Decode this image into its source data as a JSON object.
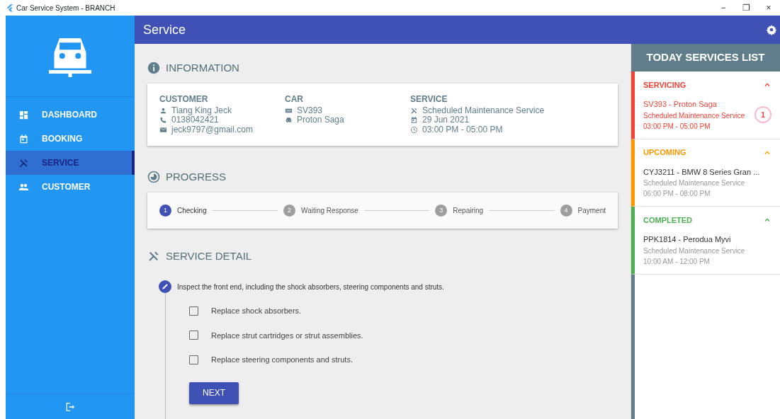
{
  "window": {
    "title": "Car Service System - BRANCH",
    "controls": [
      "−",
      "❐",
      "×"
    ]
  },
  "sidebar": {
    "items": [
      {
        "label": "DASHBOARD",
        "selected": false
      },
      {
        "label": "BOOKING",
        "selected": false
      },
      {
        "label": "SERVICE",
        "selected": true
      },
      {
        "label": "CUSTOMER",
        "selected": false
      }
    ]
  },
  "header": {
    "title": "Service"
  },
  "information": {
    "title": "INFORMATION",
    "columns": [
      {
        "heading": "CUSTOMER",
        "lines": [
          "Tiang King Jeck",
          "0138042421",
          "jeck9797@gmail.com"
        ]
      },
      {
        "heading": "CAR",
        "lines": [
          "SV393",
          "Proton Saga"
        ]
      },
      {
        "heading": "SERVICE",
        "lines": [
          "Scheduled Maintenance Service",
          "29 Jun 2021",
          "03:00 PM - 05:00 PM"
        ]
      }
    ]
  },
  "progress": {
    "title": "PROGRESS",
    "steps": [
      {
        "number": "1",
        "label": "Checking",
        "selected": true
      },
      {
        "number": "2",
        "label": "Waiting Response",
        "selected": false
      },
      {
        "number": "3",
        "label": "Repairing",
        "selected": false
      },
      {
        "number": "4",
        "label": "Payment",
        "selected": false
      }
    ]
  },
  "service_detail": {
    "title": "SERVICE DETAIL",
    "instruction": "Inspect the front end, including the shock absorbers, steering components and struts.",
    "tasks": [
      {
        "label": "Replace shock absorbers.",
        "checked": false
      },
      {
        "label": "Replace strut cartridges or strut assemblies.",
        "checked": false
      },
      {
        "label": "Replace steering components and struts.",
        "checked": false
      }
    ],
    "button": "NEXT"
  },
  "today_list": {
    "title": "TODAY SERVICES LIST",
    "groups": [
      {
        "status": "SERVICING",
        "color": "#f44336",
        "expanded": true,
        "items": [
          {
            "title": "SV393 - Proton Saga",
            "subtitle": "Scheduled Maintenance Service",
            "time": "03:00 PM - 05:00 PM",
            "badge": "1",
            "highlighted": true
          }
        ]
      },
      {
        "status": "UPCOMING",
        "color": "#ff9800",
        "expanded": true,
        "items": [
          {
            "title": "CYJ3211 - BMW 8 Series Gran ...",
            "subtitle": "Scheduled Maintenance Service",
            "time": "06:00 PM - 08:00 PM",
            "highlighted": false
          }
        ]
      },
      {
        "status": "COMPLETED",
        "color": "#4caf50",
        "expanded": true,
        "items": [
          {
            "title": "PPK1814 - Perodua Myvi",
            "subtitle": "Scheduled Maintenance Service",
            "time": "10:00 AM - 12:00 PM",
            "highlighted": false
          }
        ]
      }
    ]
  }
}
